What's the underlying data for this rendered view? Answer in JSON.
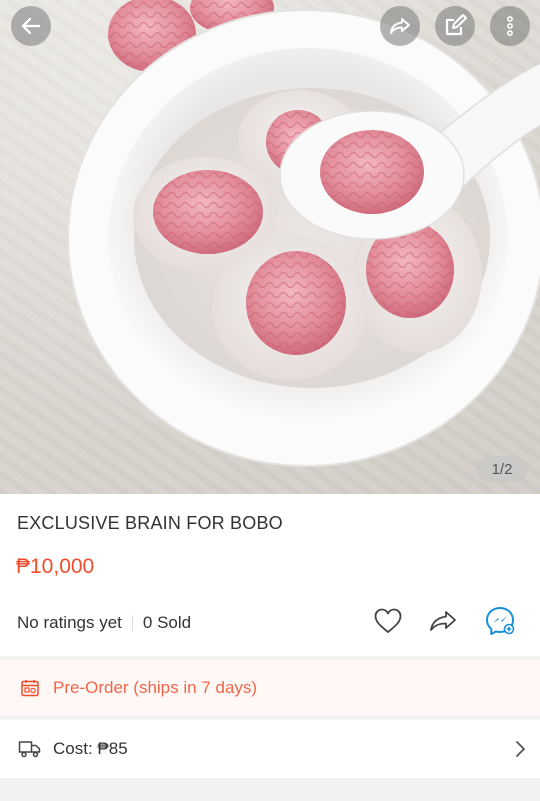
{
  "header": {
    "back_icon": "arrow-left-icon",
    "share_icon": "share-icon",
    "edit_icon": "edit-icon",
    "more_icon": "more-vertical-icon"
  },
  "gallery": {
    "counter": "1/2"
  },
  "product": {
    "title": "EXCLUSIVE BRAIN FOR BOBO",
    "price": "₱10,000",
    "ratings": "No ratings yet",
    "sold": "0 Sold"
  },
  "preorder": {
    "label": "Pre-Order (ships in 7 days)",
    "icon": "calendar-icon"
  },
  "shipping": {
    "label": "Cost: ₱85",
    "icon": "truck-icon"
  },
  "colors": {
    "accent": "#ee4d2d",
    "chat": "#1a8fd8"
  }
}
